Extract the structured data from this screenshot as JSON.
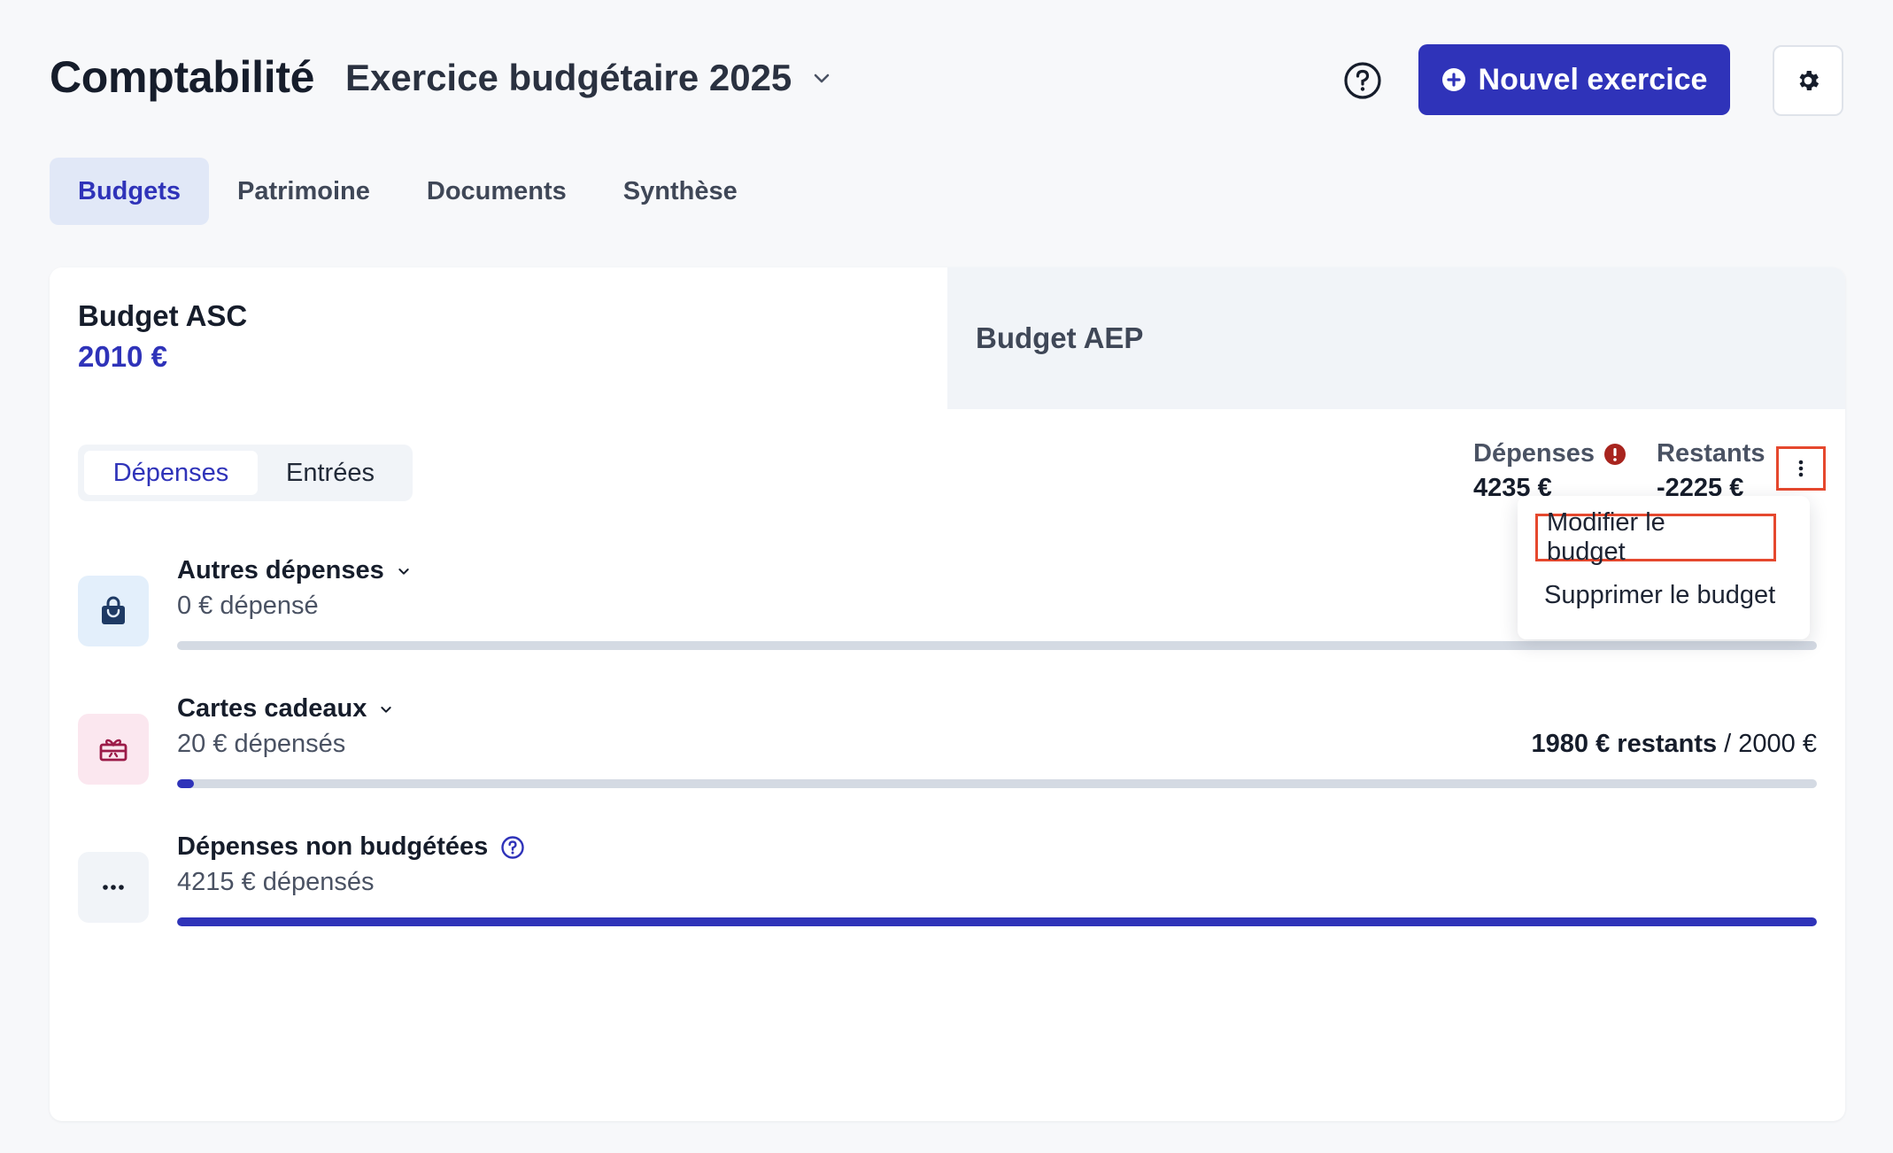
{
  "header": {
    "title": "Comptabilité",
    "exercise_label": "Exercice budgétaire 2025",
    "new_button_label": "Nouvel exercice"
  },
  "tabs": [
    {
      "label": "Budgets",
      "active": true
    },
    {
      "label": "Patrimoine",
      "active": false
    },
    {
      "label": "Documents",
      "active": false
    },
    {
      "label": "Synthèse",
      "active": false
    }
  ],
  "budgets": {
    "asc": {
      "name": "Budget ASC",
      "amount": "2010 €"
    },
    "aep": {
      "name": "Budget AEP"
    }
  },
  "segmented": {
    "depenses": "Dépenses",
    "entrees": "Entrées"
  },
  "totals": {
    "depenses_label": "Dépenses",
    "depenses_value": "4235 €",
    "restants_label": "Restants",
    "restants_value": "-2225 €"
  },
  "menu": {
    "edit": "Modifier le budget",
    "delete": "Supprimer le budget"
  },
  "categories": [
    {
      "title": "Autres dépenses",
      "spent": "0 € dépensé",
      "progress": 0.0
    },
    {
      "title": "Cartes cadeaux",
      "spent": "20 € dépensés",
      "remaining": "1980 € restants",
      "separator": " / ",
      "total": "2000 €",
      "progress": 0.01
    },
    {
      "title": "Dépenses non budgétées",
      "spent": "4215 € dépensés",
      "progress": 1.0
    }
  ],
  "colors": {
    "accent": "#2f33b9",
    "highlight_border": "#e5482e",
    "warning": "#a8241e"
  }
}
